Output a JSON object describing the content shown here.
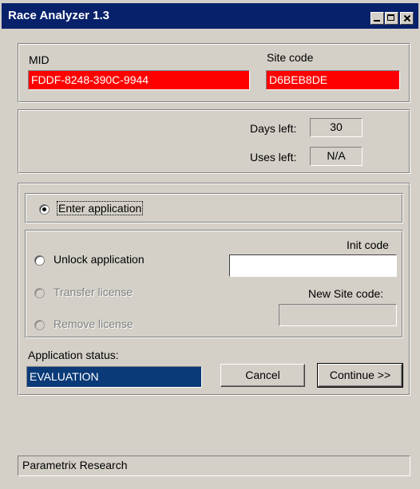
{
  "window": {
    "title": "Race Analyzer 1.3"
  },
  "ids": {
    "mid_label": "MID",
    "mid_value": "FDDF-8248-390C-9944",
    "site_code_label": "Site code",
    "site_code_value": "D6BEB8DE"
  },
  "counts": {
    "days_left_label": "Days left:",
    "days_left_value": "30",
    "uses_left_label": "Uses left:",
    "uses_left_value": "N/A"
  },
  "options": {
    "enter_application": "Enter application",
    "unlock_application": "Unlock application",
    "transfer_license": "Transfer license",
    "remove_license": "Remove license",
    "selected": "Enter application"
  },
  "codes": {
    "init_code_label": "Init code",
    "init_code_value": "",
    "new_site_code_label": "New Site code:",
    "new_site_code_value": ""
  },
  "status": {
    "label": "Application status:",
    "value": "EVALUATION"
  },
  "buttons": {
    "cancel": "Cancel",
    "continue": "Continue >>"
  },
  "footer": {
    "text": "Parametrix Research"
  },
  "colors": {
    "titlebar": "#07216b",
    "red_field": "#ff0000",
    "status_field": "#0a3a78",
    "face": "#d4d0c8"
  }
}
